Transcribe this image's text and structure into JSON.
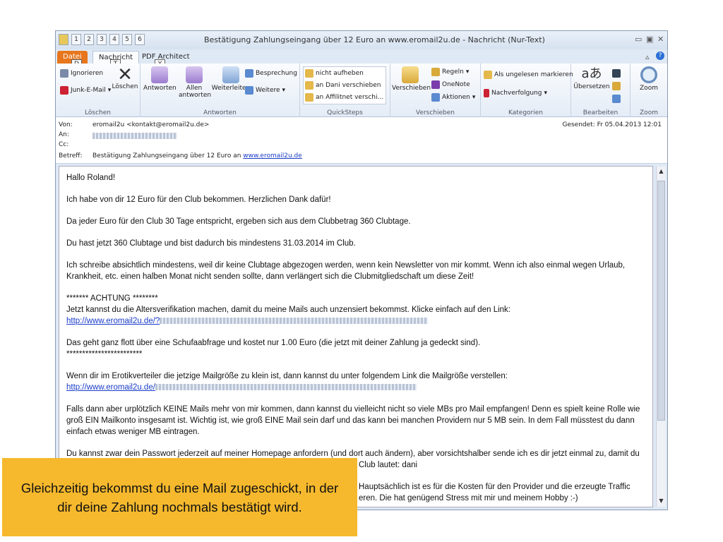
{
  "window": {
    "title": "Bestätigung Zahlungseingang über 12 Euro an www.eromail2u.de  -  Nachricht (Nur-Text)",
    "qat_keytips": [
      "1",
      "2",
      "3",
      "4",
      "5",
      "6"
    ],
    "controls": {
      "minimize": "▭",
      "restore": "▣",
      "close": "✕"
    }
  },
  "tabs": [
    {
      "label": "Datei",
      "keytip": "D"
    },
    {
      "label": "Nachricht",
      "keytip": "T"
    },
    {
      "label": "PDF Architect",
      "keytip": "Y"
    }
  ],
  "ribbon": {
    "loeschen": {
      "label": "Löschen",
      "ignorieren": "Ignorieren",
      "junk": "Junk-E-Mail",
      "loeschen_btn": "Löschen"
    },
    "antworten": {
      "label": "Antworten",
      "antworten": "Antworten",
      "allen": "Allen antworten",
      "weiterleiten": "Weiterleiten",
      "besprechung": "Besprechung",
      "weitere": "Weitere"
    },
    "quicksteps": {
      "label": "QuickSteps",
      "items": [
        "nicht aufheben",
        "an Dani verschieben",
        "an Affilitnet verschi..."
      ]
    },
    "verschieben": {
      "label": "Verschieben",
      "verschieben": "Verschieben",
      "regeln": "Regeln",
      "onenote": "OneNote",
      "aktionen": "Aktionen"
    },
    "kategorien": {
      "label": "Kategorien",
      "ungelesen": "Als ungelesen markieren",
      "nachverfolgung": "Nachverfolgung"
    },
    "bearbeiten": {
      "label": "Bearbeiten",
      "uebersetzen": "Übersetzen"
    },
    "zoom": {
      "label": "Zoom",
      "zoom": "Zoom"
    }
  },
  "header": {
    "von_label": "Von:",
    "von_value": "eromail2u <kontakt@eromail2u.de>",
    "an_label": "An:",
    "cc_label": "Cc:",
    "betreff_label": "Betreff:",
    "betreff_text": "Bestätigung Zahlungseingang über 12 Euro an",
    "betreff_link": "www.eromail2u.de",
    "gesendet": "Gesendet:  Fr 05.04.2013 12:01"
  },
  "body": {
    "greeting": "Hallo Roland!",
    "p1": "Ich habe von dir 12 Euro für den Club bekommen. Herzlichen Dank dafür!",
    "p2": "Da jeder Euro für den Club 30 Tage entspricht, ergeben sich aus dem Clubbetrag 360 Clubtage.",
    "p3": "Du hast jetzt 360 Clubtage und bist dadurch bis mindestens 31.03.2014 im Club.",
    "p4": "Ich schreibe absichtlich mindestens, weil dir keine Clubtage abgezogen werden, wenn kein Newsletter von mir kommt. Wenn ich also einmal wegen Urlaub, Krankheit, etc. einen halben Monat nicht senden sollte, dann verlängert sich die Clubmitgliedschaft um diese Zeit!",
    "achtung": "******* ACHTUNG ********",
    "p5": "Jetzt kannst du die Altersverifikation machen, damit du meine Mails auch unzensiert bekommst. Klicke einfach auf den Link:",
    "link1": "http://www.eromail2u.de/?",
    "p6": "Das geht ganz flott über eine Schufaabfrage und kostet nur 1.00 Euro (die jetzt mit deiner Zahlung ja gedeckt sind).",
    "stars": "************************",
    "p7": "Wenn dir im Erotikverteiler die jetzige Mailgröße zu klein ist, dann kannst du unter folgendem Link die Mailgröße verstellen:",
    "link2": "http://www.eromail2u.de/",
    "p8": "Falls dann aber urplötzlich KEINE Mails mehr von mir kommen, dann kannst du vielleicht nicht so viele MBs pro Mail empfangen! Denn es spielt keine Rolle wie groß EIN Mailkonto insgesamt ist. Wichtig ist, wie groß EINE Mail sein darf und das kann bei manchen Providern nur 5 MB sein. In dem Fall müsstest du dann einfach etwas weniger MB eintragen.",
    "p9": "Du kannst zwar dein Passwort jederzeit auf meiner Homepage anfordern (und dort auch ändern), aber vorsichtshalber sende ich es dir jetzt einmal zu, damit du",
    "p9b": "Club lautet: dani",
    "p10": "Hauptsächlich ist es für die Kosten für den Provider und die erzeugte Traffic",
    "p10b": "eren. Die hat genügend Stress mit mir und meinem Hobby :-)"
  },
  "caption": "Gleichzeitig bekommst du eine Mail zugeschickt, in der dir deine Zahlung nochmals bestätigt wird."
}
